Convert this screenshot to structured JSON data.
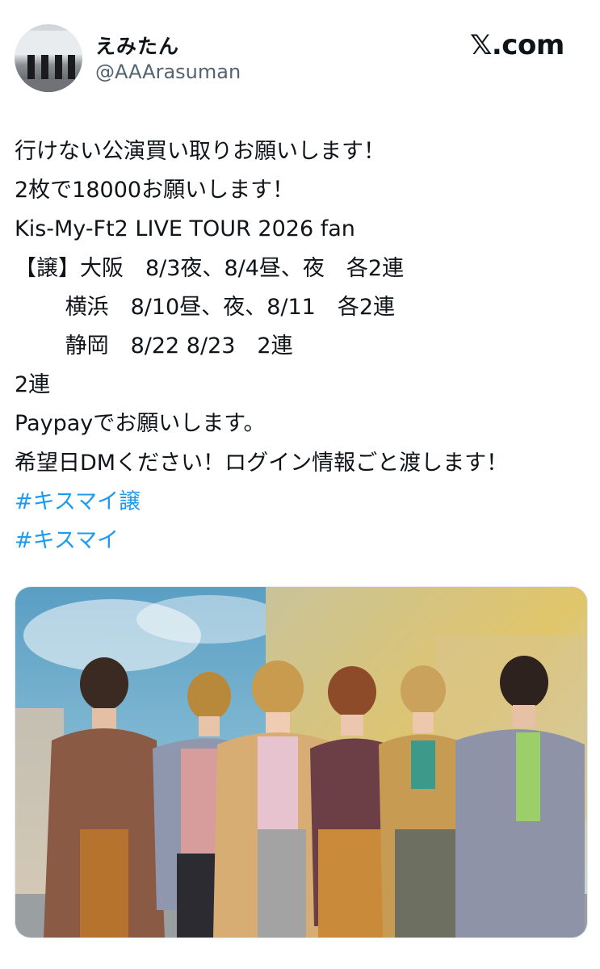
{
  "user": {
    "display_name": "えみたん",
    "handle": "@AAArasuman"
  },
  "brand": {
    "label": "𝕏.com"
  },
  "tweet": {
    "lines": [
      {
        "text": "行けない公演買い取りお願いします！",
        "hashtag": false
      },
      {
        "text": "2枚で18000お願いします！",
        "hashtag": false
      },
      {
        "text": "Kis-My-Ft2 LIVE TOUR 2026 fan",
        "hashtag": false
      },
      {
        "text": "【譲】大阪　8/3夜、8/4昼、夜　各2連",
        "hashtag": false
      },
      {
        "text": "　　 横浜　8/10昼、夜、8/11　各2連",
        "hashtag": false
      },
      {
        "text": "　　 静岡　8/22 8/23　2連",
        "hashtag": false
      },
      {
        "text": "2連",
        "hashtag": false
      },
      {
        "text": "Paypayでお願いします。",
        "hashtag": false
      },
      {
        "text": "希望日DMください！ログイン情報ごと渡します！",
        "hashtag": false
      },
      {
        "text": "#キスマイ譲",
        "hashtag": true
      },
      {
        "text": "#キスマイ",
        "hashtag": true
      }
    ]
  },
  "media": {
    "description_icon": "group-photo-icon"
  },
  "colors": {
    "hashtag": "#1d9bf0",
    "handle": "#536471",
    "text": "#0f1419"
  }
}
